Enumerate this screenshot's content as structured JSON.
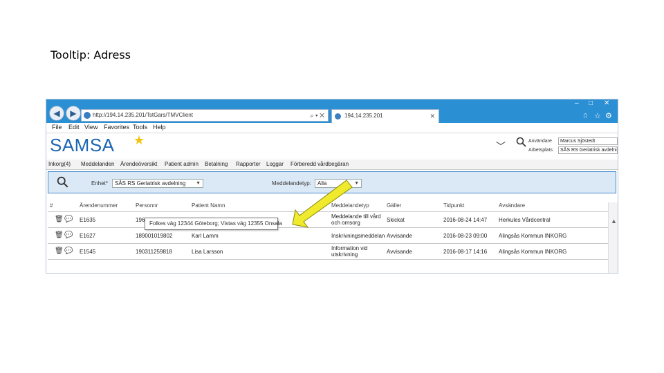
{
  "slide": {
    "title": "Tooltip: Adress"
  },
  "browser": {
    "url": "http://194.14.235.201/TstGars/TMVClient",
    "tab_title": "194.14.235.201",
    "menu": [
      "File",
      "Edit",
      "View",
      "Favorites",
      "Tools",
      "Help"
    ]
  },
  "app": {
    "logo": "SAMSA",
    "user_label": "Användare",
    "user_value": "Marcus Sjöstedt",
    "unit_label": "Arbetsplats",
    "unit_value": "SÅS RS Geriatrisk avdelning",
    "nav": [
      "Inkorg(4)",
      "Meddelanden",
      "Ärendeöversikt",
      "Patient admin",
      "Betalning",
      "Rapporter",
      "Loggar",
      "Förberedd vårdbegäran"
    ]
  },
  "filter": {
    "enhet_label": "Enhet*",
    "enhet_value": "SÅS RS Geriatrisk avdelning",
    "typ_label": "Meddelandetyp:",
    "typ_value": "Alla"
  },
  "table": {
    "headers": [
      "#",
      "Ärendenummer",
      "Personnr",
      "Patient Namn",
      "Meddelandetyp",
      "Gäller",
      "Tidpunkt",
      "Avsändare"
    ],
    "rows": [
      {
        "arende": "E1635",
        "personnr": "196",
        "namn": "",
        "typ": "Meddelande till vård och omsorg",
        "galler": "Skickat",
        "tid": "2016-08-24 14:47",
        "avsandare": "Herkules Vårdcentral"
      },
      {
        "arende": "E1627",
        "personnr": "189001019802",
        "namn": "Karl Lamm",
        "typ": "Inskrivningsmeddelande",
        "galler": "Avvisande",
        "tid": "2016-08-23 09:00",
        "avsandare": "Alingsås Kommun INKORG"
      },
      {
        "arende": "E1545",
        "personnr": "190311259818",
        "namn": "Lisa Larsson",
        "typ": "Information vid utskrivning",
        "galler": "Avvisande",
        "tid": "2016-08-17 14:16",
        "avsandare": "Alingsås Kommun INKORG"
      }
    ]
  },
  "tooltip": {
    "text": "Folkes väg 12344 Göteborg; Vistas väg 12355 Onsala"
  },
  "colors": {
    "titlebar": "#2b8fd4",
    "logo": "#1b66b3",
    "arrow": "#f2ee1c",
    "filter_bg": "#dbe9f6"
  }
}
